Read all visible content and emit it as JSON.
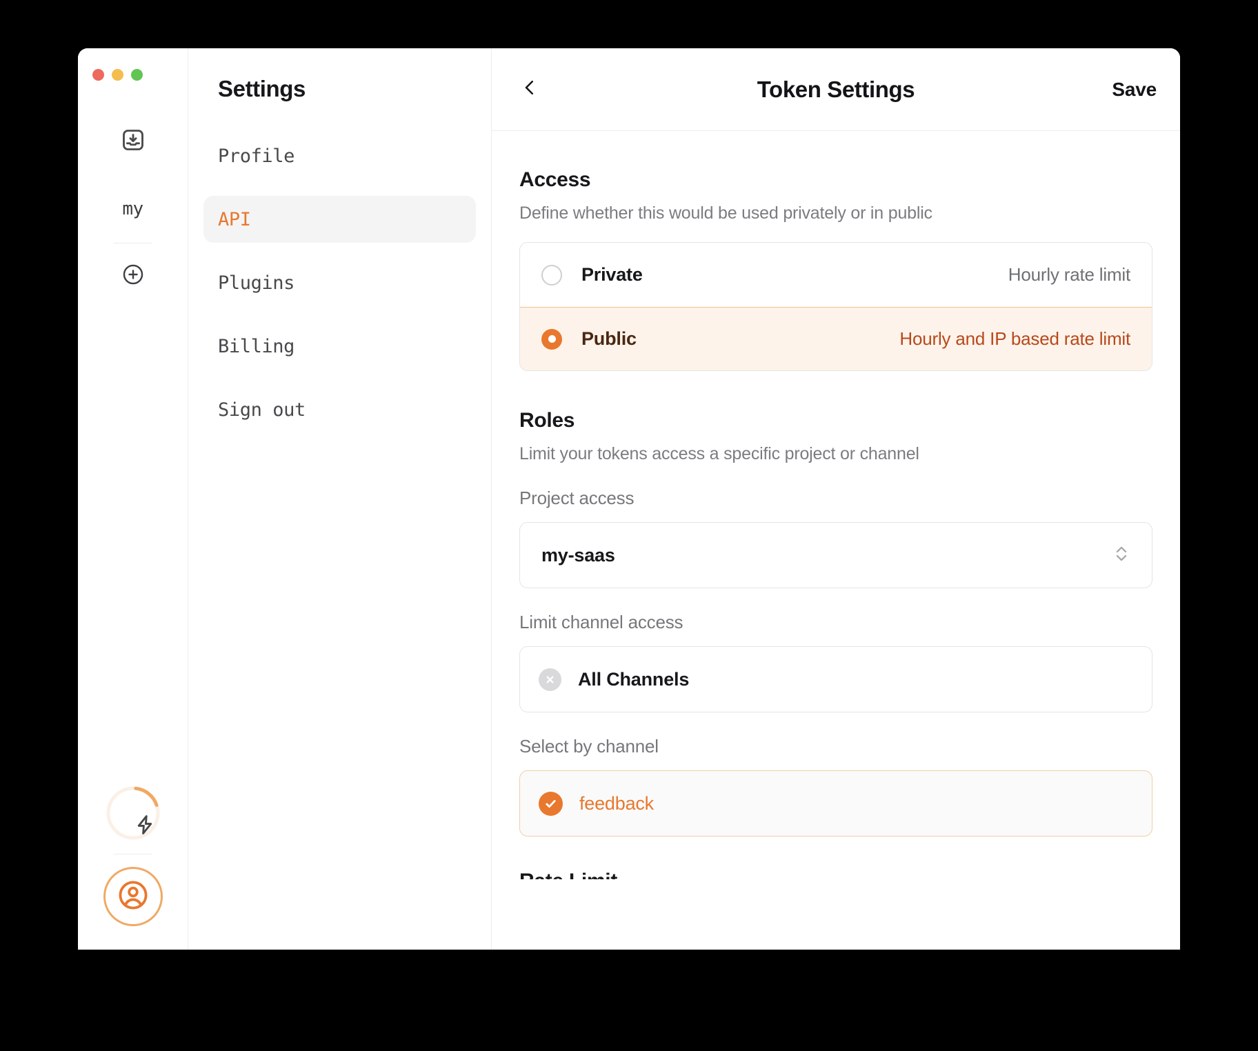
{
  "window": {
    "traffic_lights": [
      "close",
      "minimize",
      "maximize"
    ],
    "rail": {
      "inbox_icon": "inbox-download-icon",
      "workspace_label": "my",
      "add_icon": "plus-circle-icon",
      "usage_icon": "lightning-bolt-icon",
      "usage_ring_percent": 18,
      "avatar_icon": "user-circle-icon"
    }
  },
  "settings": {
    "title": "Settings",
    "items": [
      {
        "label": "Profile",
        "active": false
      },
      {
        "label": "API",
        "active": true
      },
      {
        "label": "Plugins",
        "active": false
      },
      {
        "label": "Billing",
        "active": false
      },
      {
        "label": "Sign out",
        "active": false
      }
    ]
  },
  "header": {
    "back_icon": "chevron-left-icon",
    "title": "Token Settings",
    "save_label": "Save"
  },
  "access": {
    "title": "Access",
    "subtitle": "Define whether this would be used privately or in public",
    "options": [
      {
        "label": "Private",
        "hint": "Hourly rate limit",
        "selected": false
      },
      {
        "label": "Public",
        "hint": "Hourly and IP based rate limit",
        "selected": true
      }
    ]
  },
  "roles": {
    "title": "Roles",
    "subtitle": "Limit your tokens access a specific project or channel",
    "project_access": {
      "label": "Project access",
      "value": "my-saas",
      "stepper_icon": "chevron-up-down-icon"
    },
    "limit_channel_access": {
      "label": "Limit channel access",
      "chips": [
        {
          "label": "All Channels",
          "remove_icon": "close-circle-icon"
        }
      ]
    },
    "select_by_channel": {
      "label": "Select by channel",
      "channels": [
        {
          "label": "feedback",
          "selected": true,
          "check_icon": "check-circle-icon"
        }
      ]
    }
  },
  "cutoff": {
    "title": "Rate Limit"
  },
  "colors": {
    "accent": "#e8782e",
    "accent_soft_bg": "#fdf3ea",
    "accent_soft_border": "#f1c391",
    "accent_text_dark": "#b8481c",
    "window_bg": "#ffffff",
    "page_bg": "#000000",
    "border": "#e4e4e6",
    "muted_text": "#76777b",
    "heading_text": "#17181a",
    "nav_active_bg": "#f4f4f5",
    "traffic_red": "#ec6a5e",
    "traffic_yellow": "#f4bd4f",
    "traffic_green": "#61c554"
  }
}
